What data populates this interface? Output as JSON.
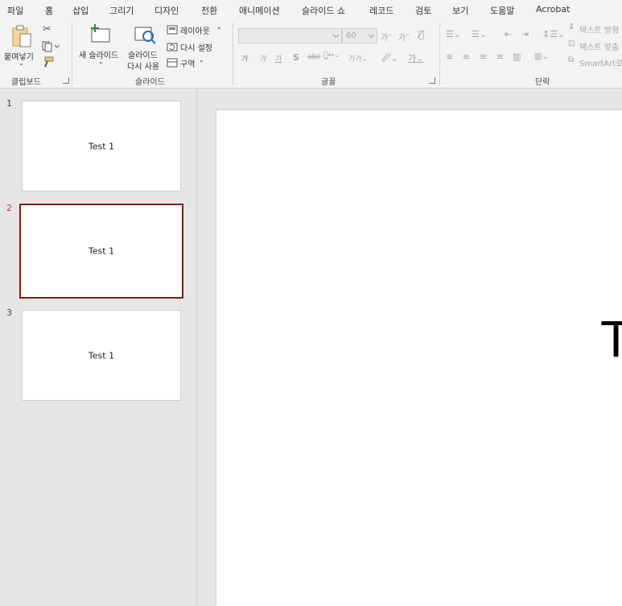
{
  "menu": {
    "tabs": [
      "파일",
      "홈",
      "삽입",
      "그리기",
      "디자인",
      "전환",
      "애니메이션",
      "슬라이드 쇼",
      "레코드",
      "검토",
      "보기",
      "도움말",
      "Acrobat"
    ],
    "active_tab": "홈"
  },
  "ribbon": {
    "clipboard": {
      "paste_label": "붙여넣기",
      "group_label": "클립보드"
    },
    "slides": {
      "new_slide_label": "새 슬라이드",
      "reuse_label_1": "슬라이드",
      "reuse_label_2": "다시 사용",
      "layout_label": "레이아웃",
      "reset_label": "다시 설정",
      "section_label": "구역",
      "group_label": "슬라이드"
    },
    "font": {
      "font_name": "",
      "font_size": "60",
      "group_label": "글꼴"
    },
    "paragraph": {
      "text_direction_label": "텍스트 방향",
      "align_text_label": "텍스트 맞춤",
      "smartart_label": "SmartArt로",
      "group_label": "단락"
    }
  },
  "slides": [
    {
      "number": "1",
      "title": "Test 1",
      "selected": false
    },
    {
      "number": "2",
      "title": "Test 1",
      "selected": true
    },
    {
      "number": "3",
      "title": "Test 1",
      "selected": false
    }
  ],
  "editor": {
    "visible_text": "T"
  },
  "colors": {
    "accent": "#c43e1c",
    "selected_border": "#7b1f17"
  }
}
